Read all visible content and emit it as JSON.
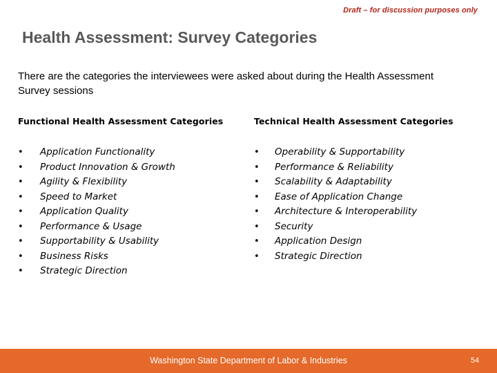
{
  "banner": {
    "text": "Draft – for discussion purposes only",
    "color": "#b02418"
  },
  "title": "Health Assessment: Survey Categories",
  "intro": "There are the categories the interviewees were asked about during the Health Assessment Survey sessions",
  "columns": {
    "left": {
      "heading": "Functional Health Assessment Categories",
      "items": [
        "Application Functionality",
        "Product Innovation & Growth",
        "Agility & Flexibility",
        "Speed to Market",
        "Application Quality",
        "Performance & Usage",
        "Supportability & Usability",
        "Business Risks",
        "Strategic Direction"
      ]
    },
    "right": {
      "heading": "Technical Health Assessment Categories",
      "items": [
        "Operability & Supportability",
        "Performance & Reliability",
        "Scalability & Adaptability",
        "Ease of Application Change",
        "Architecture & Interoperability",
        "Security",
        "Application Design",
        "Strategic Direction"
      ]
    }
  },
  "bullet_glyph": "•",
  "footer": {
    "organization": "Washington State Department of Labor & Industries",
    "page_number": "54",
    "background_color": "#e4692a",
    "text_color": "#ffffff"
  }
}
